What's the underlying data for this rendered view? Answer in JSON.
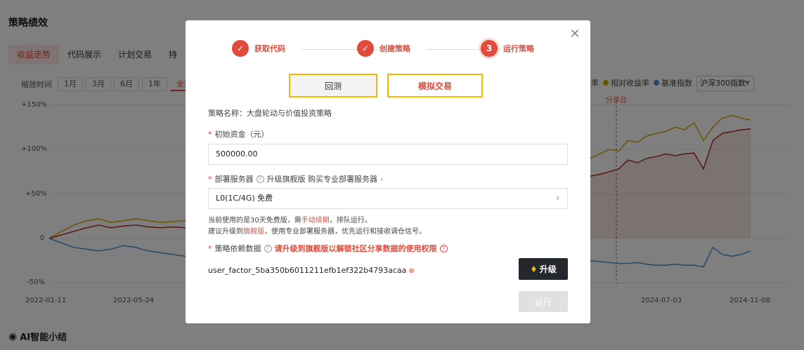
{
  "page": {
    "title": "策略绩效",
    "tabs": [
      "收益走势",
      "代码展示",
      "计划交易",
      "持"
    ],
    "range_label": "缩放时间",
    "ranges": [
      "1月",
      "3月",
      "6月",
      "1年",
      "全部"
    ],
    "active_range": "全部",
    "legend": [
      {
        "label": "益率",
        "color": "#b22c22"
      },
      {
        "label": "相对收益率",
        "color": "#d9a400"
      },
      {
        "label": "基准指数",
        "color": "#4a90d9"
      }
    ],
    "benchmark_select": "沪深300指数",
    "share_label": "分享日",
    "ai_summary": "AI智能小结"
  },
  "chart_data": {
    "type": "line",
    "y_ticks": [
      "+150%",
      "+100%",
      "+50%",
      "0",
      "-50%"
    ],
    "x_ticks_visible": [
      "2022-01-11",
      "2022-05-24",
      "2024-07-03",
      "2024-11-08"
    ],
    "ylim": [
      -50,
      150
    ],
    "share_marker": "分享日",
    "series": [
      {
        "name": "相对收益率",
        "color": "#d9a400",
        "left_segment": [
          0,
          8,
          15,
          20,
          22,
          18,
          20,
          22,
          20,
          18,
          19,
          20
        ],
        "right_segment": [
          90,
          95,
          100,
          98,
          110,
          108,
          115,
          118,
          120,
          125,
          122,
          130,
          110,
          125,
          135,
          138,
          135,
          133
        ]
      },
      {
        "name": "益率",
        "color": "#b22c22",
        "left_segment": [
          0,
          4,
          8,
          12,
          15,
          12,
          14,
          15,
          13,
          12,
          13,
          12
        ],
        "right_segment": [
          70,
          72,
          75,
          78,
          88,
          85,
          90,
          92,
          95,
          93,
          95,
          96,
          78,
          110,
          118,
          120,
          122,
          123
        ]
      },
      {
        "name": "基准指数",
        "color": "#4a90d9",
        "left_segment": [
          0,
          -5,
          -10,
          -12,
          -14,
          -12,
          -8,
          -10,
          -14,
          -16,
          -18,
          -20
        ],
        "right_segment": [
          -25,
          -26,
          -27,
          -28,
          -28,
          -27,
          -29,
          -30,
          -30,
          -29,
          -30,
          -30,
          -32,
          -10,
          -18,
          -20,
          -18,
          -14
        ]
      }
    ]
  },
  "modal": {
    "steps": [
      {
        "label": "获取代码",
        "state": "done"
      },
      {
        "label": "创建策略",
        "state": "done"
      },
      {
        "label": "运行策略",
        "state": "current",
        "number": "3"
      }
    ],
    "modes": {
      "backtest": "回测",
      "simulate": "模拟交易"
    },
    "strategy_name": "策略名称：大盘轮动与价值投资策略",
    "capital_label": "初始资金（元）",
    "capital_value": "500000.00",
    "server_label": "部署服务器",
    "server_help": "升级旗舰版 购买专业部署服务器",
    "server_value": "L0(1C/4G) 免费",
    "note1_a": "当前使用的是30天免费版，需",
    "note1_link": "手动续期",
    "note1_b": "，排队运行。",
    "note2_a": "建议升级到",
    "note2_link": "旗舰版",
    "note2_b": "，使用专业部署服务器，优先运行和接收调仓信号。",
    "data_label": "策略依赖数据",
    "data_warning": "请升级到旗舰版以解锁社区分享数据的使用权限",
    "factor": "user_factor_5ba350b6011211efb1ef322b4793acaa",
    "upgrade_label": "升级",
    "run_label": "运行"
  }
}
